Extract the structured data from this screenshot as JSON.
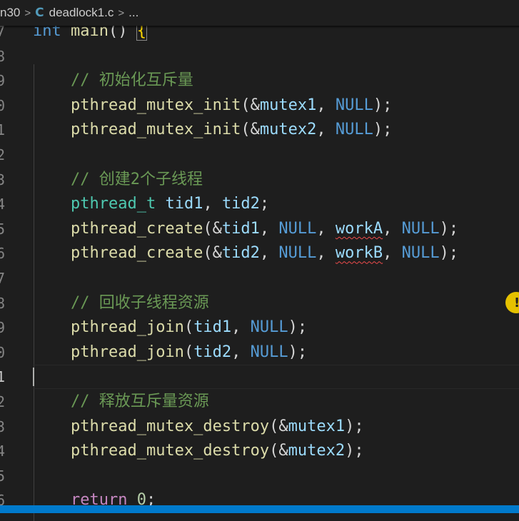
{
  "breadcrumb": {
    "folder": "n30",
    "file_icon": "C",
    "file": "deadlock1.c",
    "tail": "..."
  },
  "editor": {
    "lines": [
      {
        "n": "7",
        "tokens": [
          {
            "t": "int",
            "c": "kw"
          },
          {
            "t": " "
          },
          {
            "t": "main",
            "c": "fn"
          },
          {
            "t": "() "
          },
          {
            "t": "{",
            "c": "bracket-box"
          }
        ]
      },
      {
        "n": "8",
        "tokens": []
      },
      {
        "n": "9",
        "tokens": [
          {
            "t": "    "
          },
          {
            "t": "// 初始化互斥量",
            "c": "cm"
          }
        ]
      },
      {
        "n": "0",
        "tokens": [
          {
            "t": "    "
          },
          {
            "t": "pthread_mutex_init",
            "c": "fn"
          },
          {
            "t": "(&"
          },
          {
            "t": "mutex1",
            "c": "var"
          },
          {
            "t": ", "
          },
          {
            "t": "NULL",
            "c": "kw"
          },
          {
            "t": ");"
          }
        ]
      },
      {
        "n": "1",
        "tokens": [
          {
            "t": "    "
          },
          {
            "t": "pthread_mutex_init",
            "c": "fn"
          },
          {
            "t": "(&"
          },
          {
            "t": "mutex2",
            "c": "var"
          },
          {
            "t": ", "
          },
          {
            "t": "NULL",
            "c": "kw"
          },
          {
            "t": ");"
          }
        ]
      },
      {
        "n": "2",
        "tokens": []
      },
      {
        "n": "3",
        "tokens": [
          {
            "t": "    "
          },
          {
            "t": "// 创建2个子线程",
            "c": "cm"
          }
        ]
      },
      {
        "n": "4",
        "tokens": [
          {
            "t": "    "
          },
          {
            "t": "pthread_t",
            "c": "type"
          },
          {
            "t": " "
          },
          {
            "t": "tid1",
            "c": "var"
          },
          {
            "t": ", "
          },
          {
            "t": "tid2",
            "c": "var"
          },
          {
            "t": ";"
          }
        ]
      },
      {
        "n": "5",
        "tokens": [
          {
            "t": "    "
          },
          {
            "t": "pthread_create",
            "c": "fn"
          },
          {
            "t": "(&"
          },
          {
            "t": "tid1",
            "c": "var"
          },
          {
            "t": ", "
          },
          {
            "t": "NULL",
            "c": "kw"
          },
          {
            "t": ", "
          },
          {
            "t": "workA",
            "c": "var squiggle"
          },
          {
            "t": ", "
          },
          {
            "t": "NULL",
            "c": "kw"
          },
          {
            "t": ");"
          }
        ]
      },
      {
        "n": "6",
        "tokens": [
          {
            "t": "    "
          },
          {
            "t": "pthread_create",
            "c": "fn"
          },
          {
            "t": "(&"
          },
          {
            "t": "tid2",
            "c": "var"
          },
          {
            "t": ", "
          },
          {
            "t": "NULL",
            "c": "kw"
          },
          {
            "t": ", "
          },
          {
            "t": "workB",
            "c": "var squiggle"
          },
          {
            "t": ", "
          },
          {
            "t": "NULL",
            "c": "kw"
          },
          {
            "t": ");"
          }
        ]
      },
      {
        "n": "7",
        "tokens": []
      },
      {
        "n": "8",
        "tokens": [
          {
            "t": "    "
          },
          {
            "t": "// 回收子线程资源",
            "c": "cm"
          }
        ]
      },
      {
        "n": "9",
        "tokens": [
          {
            "t": "    "
          },
          {
            "t": "pthread_join",
            "c": "fn"
          },
          {
            "t": "("
          },
          {
            "t": "tid1",
            "c": "var"
          },
          {
            "t": ", "
          },
          {
            "t": "NULL",
            "c": "kw"
          },
          {
            "t": ");"
          }
        ]
      },
      {
        "n": "0",
        "tokens": [
          {
            "t": "    "
          },
          {
            "t": "pthread_join",
            "c": "fn"
          },
          {
            "t": "("
          },
          {
            "t": "tid2",
            "c": "var"
          },
          {
            "t": ", "
          },
          {
            "t": "NULL",
            "c": "kw"
          },
          {
            "t": ");"
          }
        ]
      },
      {
        "n": "1",
        "tokens": [],
        "active": true
      },
      {
        "n": "2",
        "tokens": [
          {
            "t": "    "
          },
          {
            "t": "// 释放互斥量资源",
            "c": "cm"
          }
        ]
      },
      {
        "n": "3",
        "tokens": [
          {
            "t": "    "
          },
          {
            "t": "pthread_mutex_destroy",
            "c": "fn"
          },
          {
            "t": "(&"
          },
          {
            "t": "mutex1",
            "c": "var"
          },
          {
            "t": ");"
          }
        ]
      },
      {
        "n": "4",
        "tokens": [
          {
            "t": "    "
          },
          {
            "t": "pthread_mutex_destroy",
            "c": "fn"
          },
          {
            "t": "(&"
          },
          {
            "t": "mutex2",
            "c": "var"
          },
          {
            "t": ");"
          }
        ]
      },
      {
        "n": "5",
        "tokens": []
      },
      {
        "n": "6",
        "tokens": [
          {
            "t": "    "
          },
          {
            "t": "return",
            "c": "ctl"
          },
          {
            "t": " "
          },
          {
            "t": "0",
            "c": "num"
          },
          {
            "t": ";"
          }
        ]
      }
    ]
  },
  "lightbulb": {
    "glyph": "!"
  },
  "statusbar": {
    "right_text": ""
  }
}
